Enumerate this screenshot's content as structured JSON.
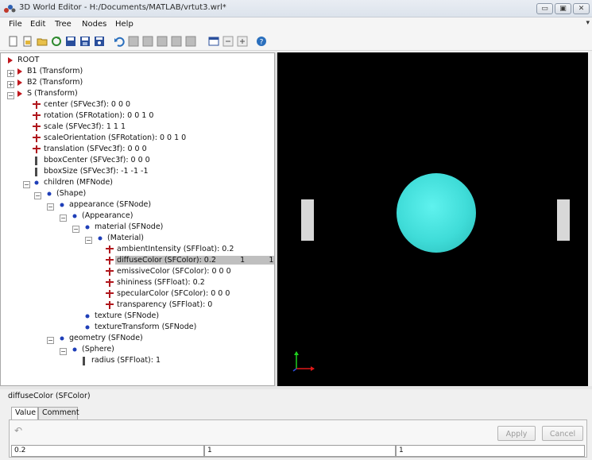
{
  "window": {
    "title": "3D World Editor - H:/Documents/MATLAB/vrtut3.wrl*"
  },
  "window_buttons": {
    "minimize": "▭",
    "maximize": "▣",
    "close": "✕"
  },
  "menu": [
    "File",
    "Edit",
    "Tree",
    "Nodes",
    "Help"
  ],
  "menu_pin": "▾",
  "toolbar_icons": [
    "new-icon",
    "open-icon",
    "open-folder-icon",
    "reload-icon",
    "save-icon",
    "save-as-icon",
    "save-copy-icon",
    "undo-icon",
    "node-icon-1",
    "node-icon-2",
    "node-icon-3",
    "node-icon-4",
    "node-icon-5",
    "view-icon",
    "collapse-icon",
    "expand-icon",
    "help-icon"
  ],
  "tree": {
    "rows": [
      {
        "label": "ROOT"
      },
      {
        "label": "B1 (Transform)"
      },
      {
        "label": "B2 (Transform)"
      },
      {
        "label": "S (Transform)"
      },
      {
        "label": "center (SFVec3f): 0 0 0"
      },
      {
        "label": "rotation (SFRotation): 0 0 1 0"
      },
      {
        "label": "scale (SFVec3f): 1 1 1"
      },
      {
        "label": "scaleOrientation (SFRotation): 0 0 1 0"
      },
      {
        "label": "translation (SFVec3f): 0 0 0"
      },
      {
        "label": "bboxCenter (SFVec3f): 0 0 0"
      },
      {
        "label": "bboxSize (SFVec3f): -1 -1 -1"
      },
      {
        "label": "children (MFNode)"
      },
      {
        "label": "(Shape)"
      },
      {
        "label": "appearance (SFNode)"
      },
      {
        "label": "(Appearance)"
      },
      {
        "label": "material (SFNode)"
      },
      {
        "label": "(Material)"
      },
      {
        "label": "ambientIntensity (SFFloat): 0.2"
      },
      {
        "label": "diffuseColor (SFColor): 0.2          1          1"
      },
      {
        "label": "emissiveColor (SFColor): 0 0 0"
      },
      {
        "label": "shininess (SFFloat): 0.2"
      },
      {
        "label": "specularColor (SFColor): 0 0 0"
      },
      {
        "label": "transparency (SFFloat): 0"
      },
      {
        "label": "texture (SFNode)"
      },
      {
        "label": "textureTransform (SFNode)"
      },
      {
        "label": "geometry (SFNode)"
      },
      {
        "label": "(Sphere)"
      },
      {
        "label": "radius (SFFloat): 1"
      }
    ]
  },
  "viewport": {
    "sphere_color": "#3fdcd8",
    "background": "#000000"
  },
  "editor": {
    "field_name": "diffuseColor (SFColor)",
    "tabs": [
      "Value",
      "Comment"
    ],
    "apply_label": "Apply",
    "cancel_label": "Cancel",
    "values": [
      "0.2",
      "1",
      "1"
    ]
  }
}
